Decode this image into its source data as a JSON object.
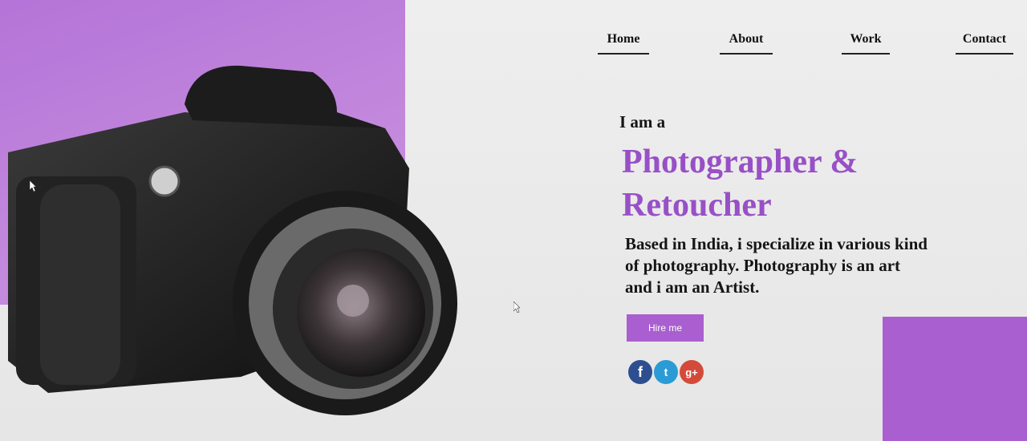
{
  "nav": {
    "home": "Home",
    "about": "About",
    "work": "Work",
    "contact": "Contact"
  },
  "hero": {
    "intro": "I am a",
    "headline_line1": "Photographer &",
    "headline_line2": "Retoucher",
    "bio": "Based in India, i specialize in various kind of photography. Photography is an art and i am an Artist.",
    "hire_button": "Hire me"
  },
  "social": {
    "facebook": "f",
    "twitter": "t",
    "google_plus": "g+"
  },
  "colors": {
    "accent": "#a95fcf",
    "headline": "#9850c6",
    "panel": "#c389dd"
  }
}
